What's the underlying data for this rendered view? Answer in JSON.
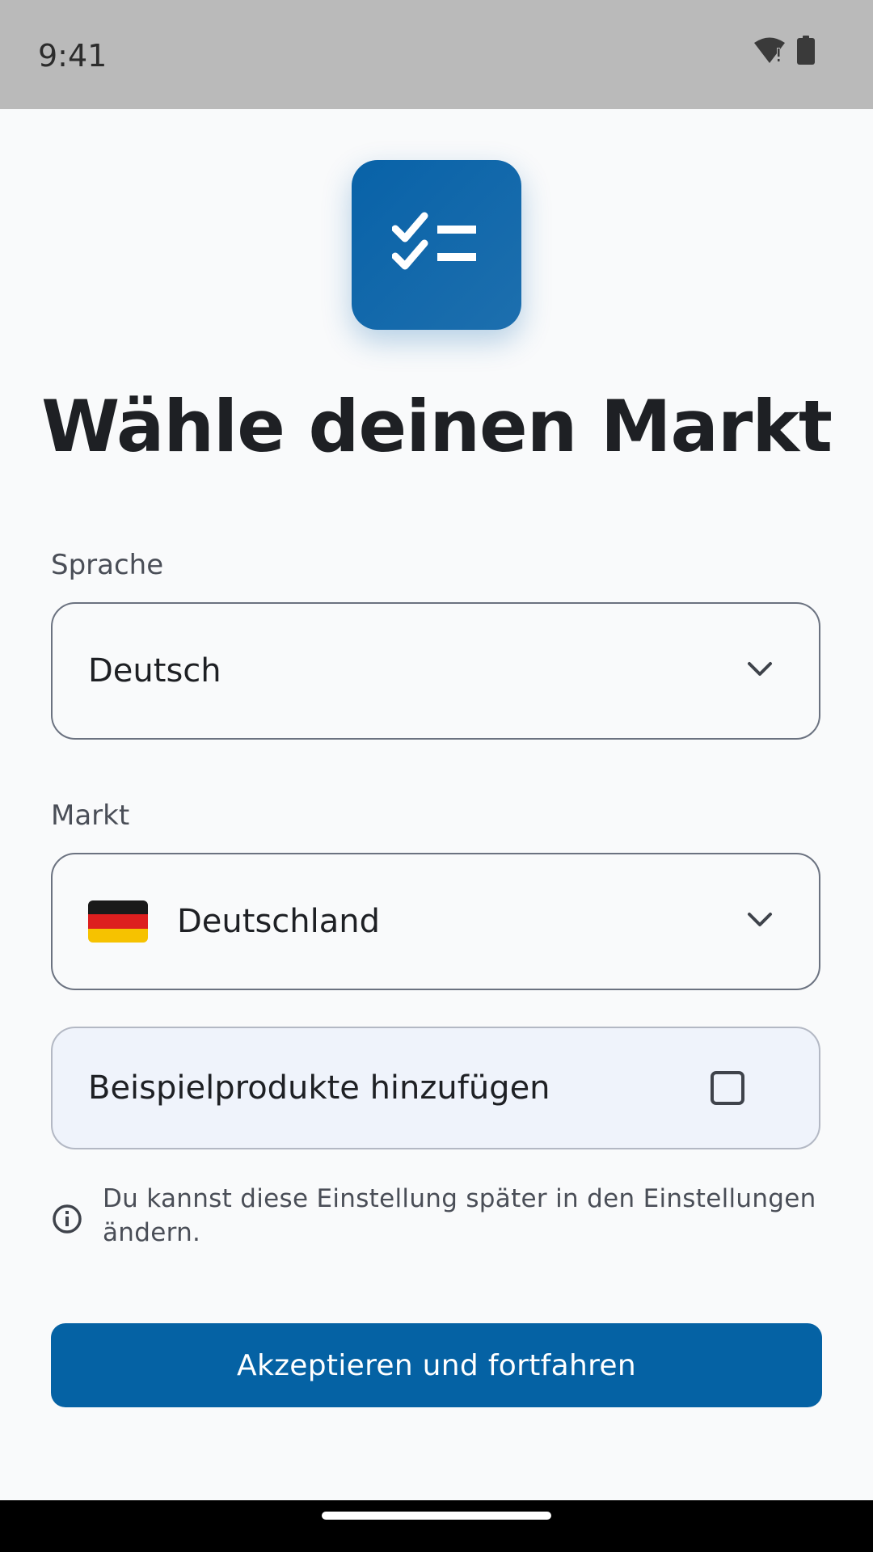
{
  "status_bar": {
    "time": "9:41",
    "icons": [
      "wifi-icon",
      "battery-icon"
    ]
  },
  "header": {
    "logo_icon": "checklist-icon",
    "title": "Wähle deinen Markt"
  },
  "language": {
    "label": "Sprache",
    "value": "Deutsch",
    "icon": "chevron-down-icon"
  },
  "market": {
    "label": "Markt",
    "value": "Deutschland",
    "flag_icon": "germany-flag-icon",
    "icon": "chevron-down-icon"
  },
  "sample_products": {
    "label": "Beispielprodukte hinzufügen",
    "checked": false
  },
  "info": {
    "icon": "info-icon",
    "text": "Du kannst diese Einstellung später in den Einstellungen ändern."
  },
  "button": {
    "label": "Akzeptieren und fortfahren"
  },
  "colors": {
    "primary": "#0562a4",
    "background": "#f9fafb",
    "status_bar": "#bababa",
    "checkbox_row_bg": "#eff3fb"
  }
}
